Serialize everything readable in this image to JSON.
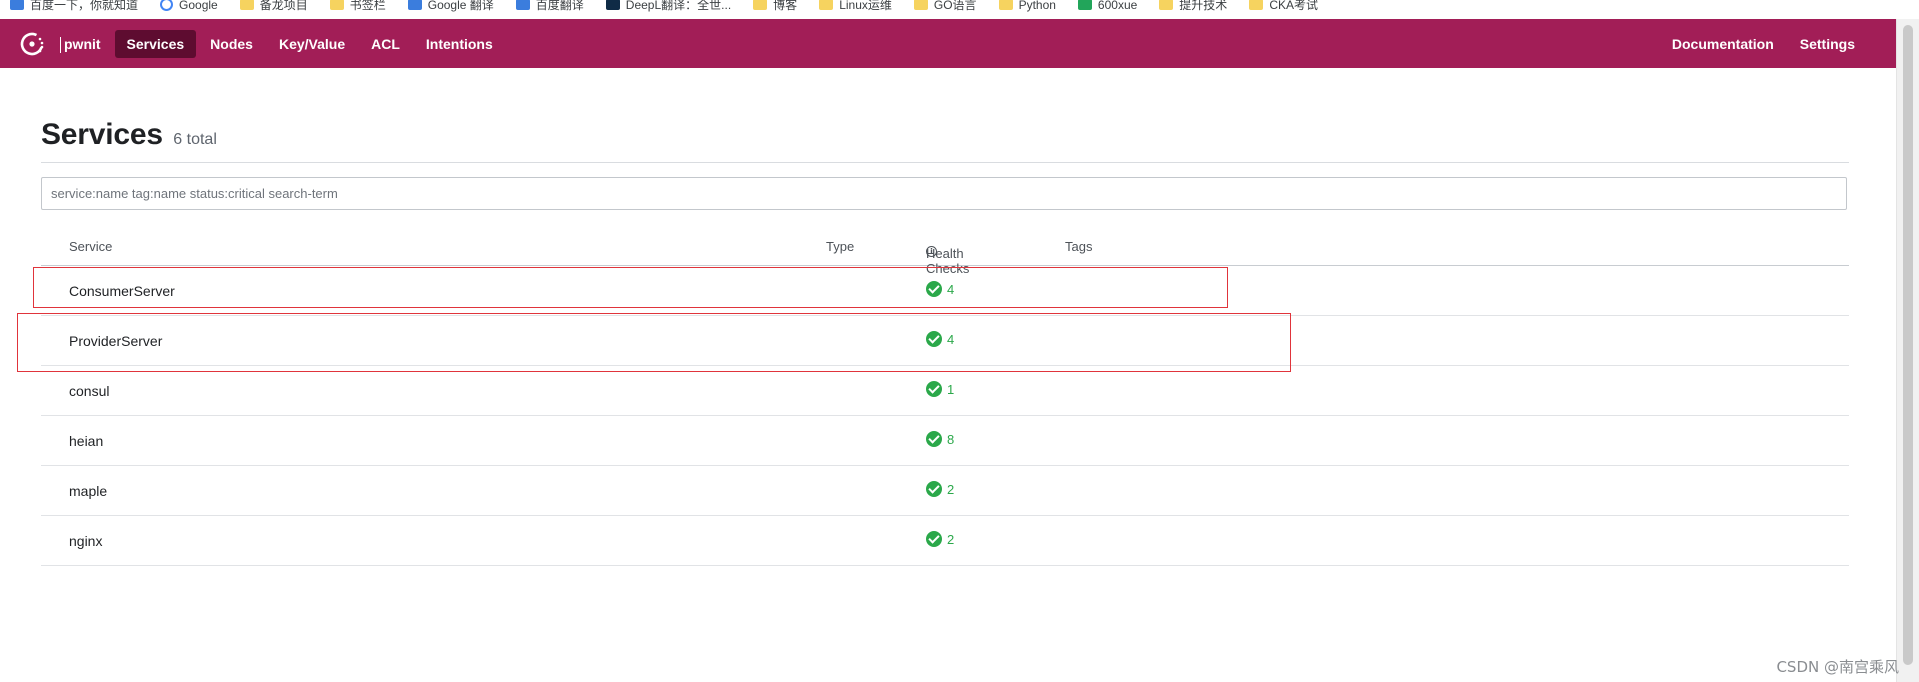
{
  "bookmarks": [
    {
      "icon": "paw-icon",
      "label": "百度一下，你就知道"
    },
    {
      "icon": "google-icon",
      "label": "Google"
    },
    {
      "icon": "folder-icon",
      "label": "备龙项目"
    },
    {
      "icon": "folder-icon",
      "label": "书签栏"
    },
    {
      "icon": "google-translate-icon",
      "label": "Google 翻译"
    },
    {
      "icon": "baidu-translate-icon",
      "label": "百度翻译"
    },
    {
      "icon": "deepl-icon",
      "label": "DeepL翻译：全世..."
    },
    {
      "icon": "folder-icon",
      "label": "博客"
    },
    {
      "icon": "folder-icon",
      "label": "Linux运维"
    },
    {
      "icon": "folder-icon",
      "label": "GO语言"
    },
    {
      "icon": "folder-icon",
      "label": "Python"
    },
    {
      "icon": "sheet-icon",
      "label": "600xue"
    },
    {
      "icon": "folder-icon",
      "label": "提升技术"
    },
    {
      "icon": "folder-icon",
      "label": "CKA考试"
    }
  ],
  "nav": {
    "datacenter": "pwnit",
    "items": [
      "Services",
      "Nodes",
      "Key/Value",
      "ACL",
      "Intentions"
    ],
    "active": "Services",
    "right": [
      "Documentation",
      "Settings"
    ]
  },
  "page": {
    "title": "Services",
    "total": "6 total"
  },
  "search": {
    "placeholder": "service:name tag:name status:critical search-term",
    "value": ""
  },
  "table": {
    "headers": {
      "service": "Service",
      "type": "Type",
      "health": "Health Checks",
      "tags": "Tags"
    },
    "rows": [
      {
        "name": "ConsumerServer",
        "checks": "4"
      },
      {
        "name": "ProviderServer",
        "checks": "4"
      },
      {
        "name": "consul",
        "checks": "1"
      },
      {
        "name": "heian",
        "checks": "8"
      },
      {
        "name": "maple",
        "checks": "2"
      },
      {
        "name": "nginx",
        "checks": "2"
      }
    ]
  },
  "colors": {
    "brand": "#a21e57",
    "active_nav": "#5e0c30",
    "passing": "#2ba84a",
    "annotation": "#e0343b"
  },
  "watermark": "CSDN @南宫乘风"
}
